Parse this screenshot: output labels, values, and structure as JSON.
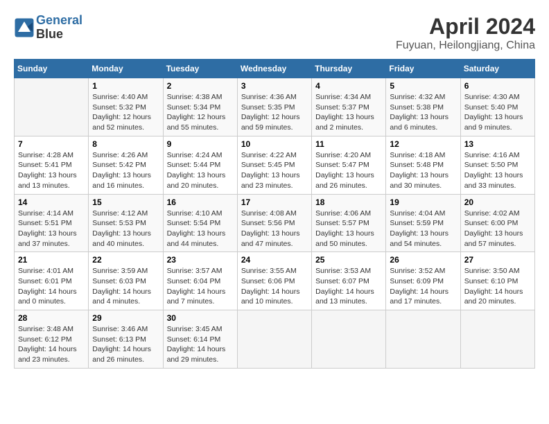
{
  "header": {
    "logo_line1": "General",
    "logo_line2": "Blue",
    "title": "April 2024",
    "subtitle": "Fuyuan, Heilongjiang, China"
  },
  "days_of_week": [
    "Sunday",
    "Monday",
    "Tuesday",
    "Wednesday",
    "Thursday",
    "Friday",
    "Saturday"
  ],
  "weeks": [
    [
      {
        "num": "",
        "info": ""
      },
      {
        "num": "1",
        "info": "Sunrise: 4:40 AM\nSunset: 5:32 PM\nDaylight: 12 hours\nand 52 minutes."
      },
      {
        "num": "2",
        "info": "Sunrise: 4:38 AM\nSunset: 5:34 PM\nDaylight: 12 hours\nand 55 minutes."
      },
      {
        "num": "3",
        "info": "Sunrise: 4:36 AM\nSunset: 5:35 PM\nDaylight: 12 hours\nand 59 minutes."
      },
      {
        "num": "4",
        "info": "Sunrise: 4:34 AM\nSunset: 5:37 PM\nDaylight: 13 hours\nand 2 minutes."
      },
      {
        "num": "5",
        "info": "Sunrise: 4:32 AM\nSunset: 5:38 PM\nDaylight: 13 hours\nand 6 minutes."
      },
      {
        "num": "6",
        "info": "Sunrise: 4:30 AM\nSunset: 5:40 PM\nDaylight: 13 hours\nand 9 minutes."
      }
    ],
    [
      {
        "num": "7",
        "info": "Sunrise: 4:28 AM\nSunset: 5:41 PM\nDaylight: 13 hours\nand 13 minutes."
      },
      {
        "num": "8",
        "info": "Sunrise: 4:26 AM\nSunset: 5:42 PM\nDaylight: 13 hours\nand 16 minutes."
      },
      {
        "num": "9",
        "info": "Sunrise: 4:24 AM\nSunset: 5:44 PM\nDaylight: 13 hours\nand 20 minutes."
      },
      {
        "num": "10",
        "info": "Sunrise: 4:22 AM\nSunset: 5:45 PM\nDaylight: 13 hours\nand 23 minutes."
      },
      {
        "num": "11",
        "info": "Sunrise: 4:20 AM\nSunset: 5:47 PM\nDaylight: 13 hours\nand 26 minutes."
      },
      {
        "num": "12",
        "info": "Sunrise: 4:18 AM\nSunset: 5:48 PM\nDaylight: 13 hours\nand 30 minutes."
      },
      {
        "num": "13",
        "info": "Sunrise: 4:16 AM\nSunset: 5:50 PM\nDaylight: 13 hours\nand 33 minutes."
      }
    ],
    [
      {
        "num": "14",
        "info": "Sunrise: 4:14 AM\nSunset: 5:51 PM\nDaylight: 13 hours\nand 37 minutes."
      },
      {
        "num": "15",
        "info": "Sunrise: 4:12 AM\nSunset: 5:53 PM\nDaylight: 13 hours\nand 40 minutes."
      },
      {
        "num": "16",
        "info": "Sunrise: 4:10 AM\nSunset: 5:54 PM\nDaylight: 13 hours\nand 44 minutes."
      },
      {
        "num": "17",
        "info": "Sunrise: 4:08 AM\nSunset: 5:56 PM\nDaylight: 13 hours\nand 47 minutes."
      },
      {
        "num": "18",
        "info": "Sunrise: 4:06 AM\nSunset: 5:57 PM\nDaylight: 13 hours\nand 50 minutes."
      },
      {
        "num": "19",
        "info": "Sunrise: 4:04 AM\nSunset: 5:59 PM\nDaylight: 13 hours\nand 54 minutes."
      },
      {
        "num": "20",
        "info": "Sunrise: 4:02 AM\nSunset: 6:00 PM\nDaylight: 13 hours\nand 57 minutes."
      }
    ],
    [
      {
        "num": "21",
        "info": "Sunrise: 4:01 AM\nSunset: 6:01 PM\nDaylight: 14 hours\nand 0 minutes."
      },
      {
        "num": "22",
        "info": "Sunrise: 3:59 AM\nSunset: 6:03 PM\nDaylight: 14 hours\nand 4 minutes."
      },
      {
        "num": "23",
        "info": "Sunrise: 3:57 AM\nSunset: 6:04 PM\nDaylight: 14 hours\nand 7 minutes."
      },
      {
        "num": "24",
        "info": "Sunrise: 3:55 AM\nSunset: 6:06 PM\nDaylight: 14 hours\nand 10 minutes."
      },
      {
        "num": "25",
        "info": "Sunrise: 3:53 AM\nSunset: 6:07 PM\nDaylight: 14 hours\nand 13 minutes."
      },
      {
        "num": "26",
        "info": "Sunrise: 3:52 AM\nSunset: 6:09 PM\nDaylight: 14 hours\nand 17 minutes."
      },
      {
        "num": "27",
        "info": "Sunrise: 3:50 AM\nSunset: 6:10 PM\nDaylight: 14 hours\nand 20 minutes."
      }
    ],
    [
      {
        "num": "28",
        "info": "Sunrise: 3:48 AM\nSunset: 6:12 PM\nDaylight: 14 hours\nand 23 minutes."
      },
      {
        "num": "29",
        "info": "Sunrise: 3:46 AM\nSunset: 6:13 PM\nDaylight: 14 hours\nand 26 minutes."
      },
      {
        "num": "30",
        "info": "Sunrise: 3:45 AM\nSunset: 6:14 PM\nDaylight: 14 hours\nand 29 minutes."
      },
      {
        "num": "",
        "info": ""
      },
      {
        "num": "",
        "info": ""
      },
      {
        "num": "",
        "info": ""
      },
      {
        "num": "",
        "info": ""
      }
    ]
  ]
}
